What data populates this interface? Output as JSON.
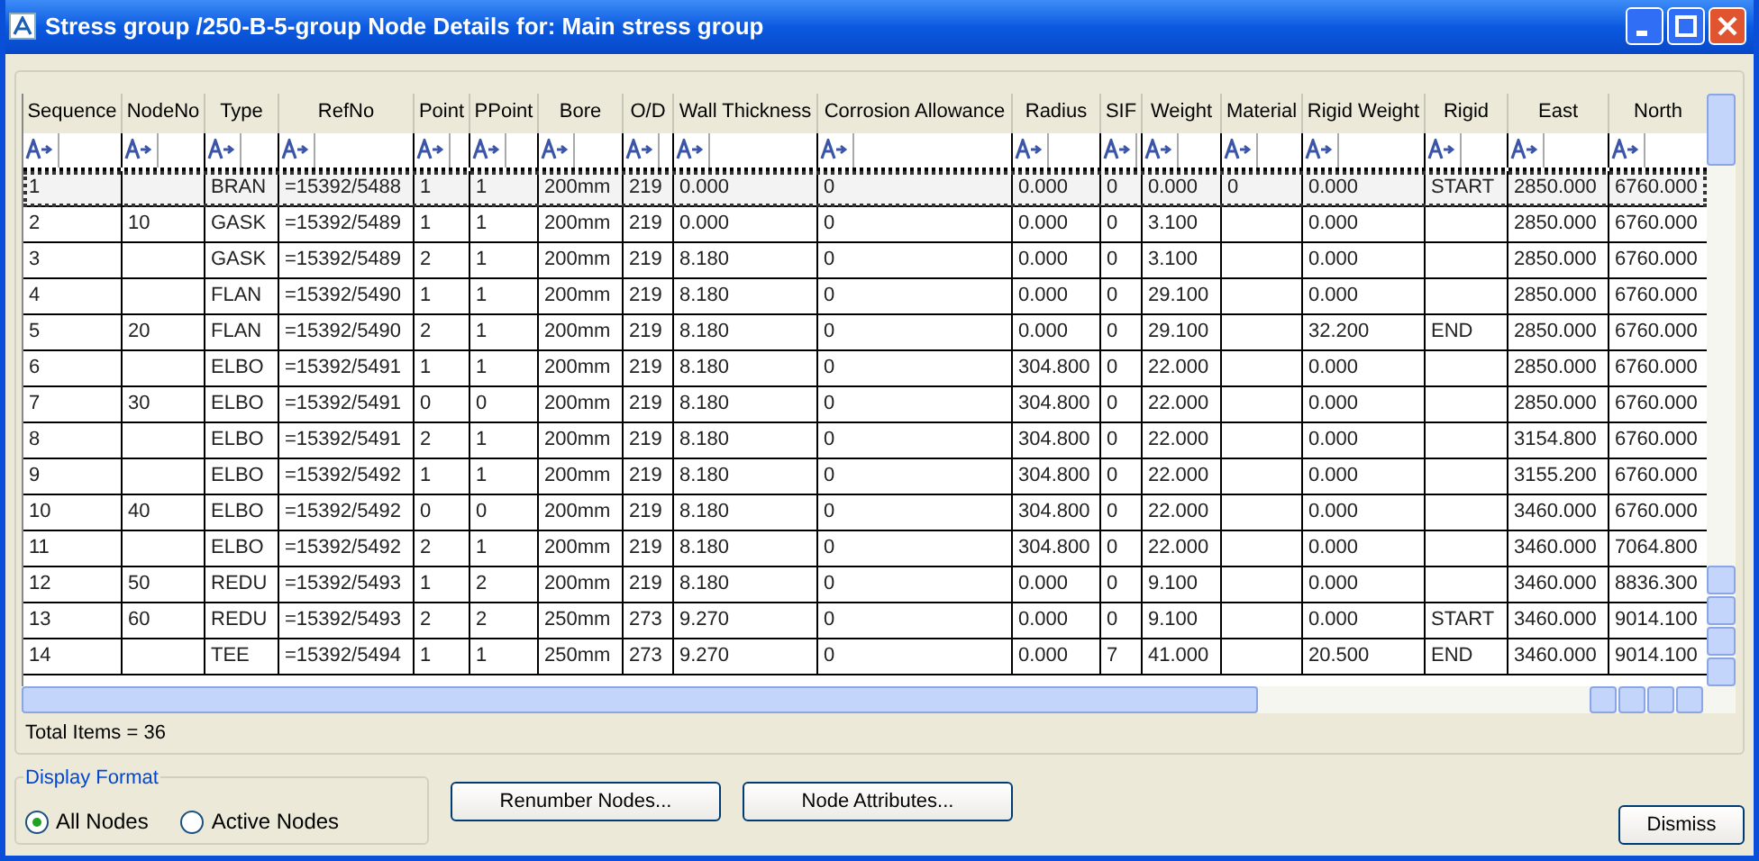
{
  "window": {
    "title": "Stress group /250-B-5-group Node Details for: Main stress group"
  },
  "table": {
    "columns": [
      "Sequence",
      "NodeNo",
      "Type",
      "RefNo",
      "Point",
      "PPoint",
      "Bore",
      "O/D",
      "Wall Thickness",
      "Corrosion Allowance",
      "Radius",
      "SIF",
      "Weight",
      "Material",
      "Rigid Weight",
      "Rigid",
      "East",
      "North"
    ],
    "rows": [
      {
        "focused": true,
        "cells": [
          "1",
          "",
          "BRAN",
          "=15392/5488",
          "1",
          "1",
          "200mm",
          "219",
          "0.000",
          "0",
          "0.000",
          "0",
          "0.000",
          "0",
          "0.000",
          "START",
          "2850.000",
          "6760.000"
        ]
      },
      {
        "focused": false,
        "cells": [
          "2",
          "10",
          "GASK",
          "=15392/5489",
          "1",
          "1",
          "200mm",
          "219",
          "0.000",
          "0",
          "0.000",
          "0",
          "3.100",
          "",
          "0.000",
          "",
          "2850.000",
          "6760.000"
        ]
      },
      {
        "focused": false,
        "cells": [
          "3",
          "",
          "GASK",
          "=15392/5489",
          "2",
          "1",
          "200mm",
          "219",
          "8.180",
          "0",
          "0.000",
          "0",
          "3.100",
          "",
          "0.000",
          "",
          "2850.000",
          "6760.000"
        ]
      },
      {
        "focused": false,
        "cells": [
          "4",
          "",
          "FLAN",
          "=15392/5490",
          "1",
          "1",
          "200mm",
          "219",
          "8.180",
          "0",
          "0.000",
          "0",
          "29.100",
          "",
          "0.000",
          "",
          "2850.000",
          "6760.000"
        ]
      },
      {
        "focused": false,
        "cells": [
          "5",
          "20",
          "FLAN",
          "=15392/5490",
          "2",
          "1",
          "200mm",
          "219",
          "8.180",
          "0",
          "0.000",
          "0",
          "29.100",
          "",
          "32.200",
          "END",
          "2850.000",
          "6760.000"
        ]
      },
      {
        "focused": false,
        "cells": [
          "6",
          "",
          "ELBO",
          "=15392/5491",
          "1",
          "1",
          "200mm",
          "219",
          "8.180",
          "0",
          "304.800",
          "0",
          "22.000",
          "",
          "0.000",
          "",
          "2850.000",
          "6760.000"
        ]
      },
      {
        "focused": false,
        "cells": [
          "7",
          "30",
          "ELBO",
          "=15392/5491",
          "0",
          "0",
          "200mm",
          "219",
          "8.180",
          "0",
          "304.800",
          "0",
          "22.000",
          "",
          "0.000",
          "",
          "2850.000",
          "6760.000"
        ]
      },
      {
        "focused": false,
        "cells": [
          "8",
          "",
          "ELBO",
          "=15392/5491",
          "2",
          "1",
          "200mm",
          "219",
          "8.180",
          "0",
          "304.800",
          "0",
          "22.000",
          "",
          "0.000",
          "",
          "3154.800",
          "6760.000"
        ]
      },
      {
        "focused": false,
        "cells": [
          "9",
          "",
          "ELBO",
          "=15392/5492",
          "1",
          "1",
          "200mm",
          "219",
          "8.180",
          "0",
          "304.800",
          "0",
          "22.000",
          "",
          "0.000",
          "",
          "3155.200",
          "6760.000"
        ]
      },
      {
        "focused": false,
        "cells": [
          "10",
          "40",
          "ELBO",
          "=15392/5492",
          "0",
          "0",
          "200mm",
          "219",
          "8.180",
          "0",
          "304.800",
          "0",
          "22.000",
          "",
          "0.000",
          "",
          "3460.000",
          "6760.000"
        ]
      },
      {
        "focused": false,
        "cells": [
          "11",
          "",
          "ELBO",
          "=15392/5492",
          "2",
          "1",
          "200mm",
          "219",
          "8.180",
          "0",
          "304.800",
          "0",
          "22.000",
          "",
          "0.000",
          "",
          "3460.000",
          "7064.800"
        ]
      },
      {
        "focused": false,
        "cells": [
          "12",
          "50",
          "REDU",
          "=15392/5493",
          "1",
          "2",
          "200mm",
          "219",
          "8.180",
          "0",
          "0.000",
          "0",
          "9.100",
          "",
          "0.000",
          "",
          "3460.000",
          "8836.300"
        ]
      },
      {
        "focused": false,
        "cells": [
          "13",
          "60",
          "REDU",
          "=15392/5493",
          "2",
          "2",
          "250mm",
          "273",
          "9.270",
          "0",
          "0.000",
          "0",
          "9.100",
          "",
          "0.000",
          "START",
          "3460.000",
          "9014.100"
        ]
      },
      {
        "focused": false,
        "cells": [
          "14",
          "",
          "TEE",
          "=15392/5494",
          "1",
          "1",
          "250mm",
          "273",
          "9.270",
          "0",
          "0.000",
          "7",
          "41.000",
          "",
          "20.500",
          "END",
          "3460.000",
          "9014.100"
        ]
      }
    ]
  },
  "total_items": "Total Items = 36",
  "display_format": {
    "title": "Display Format",
    "options": [
      {
        "label": "All Nodes",
        "selected": true
      },
      {
        "label": "Active Nodes",
        "selected": false
      }
    ]
  },
  "buttons": [
    "Renumber Nodes...",
    "Node Attributes..."
  ],
  "dismiss": "Dismiss"
}
